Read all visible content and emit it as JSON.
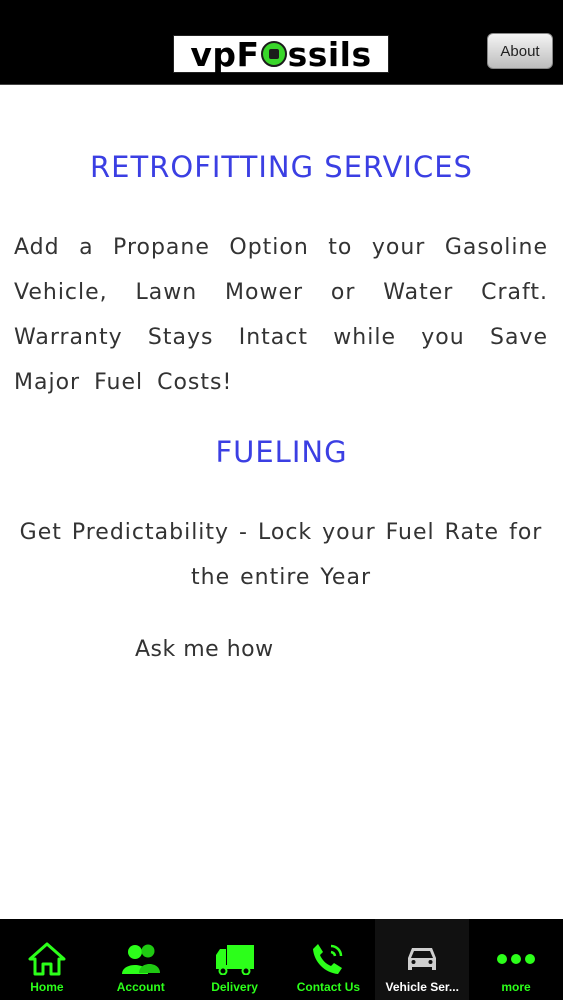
{
  "header": {
    "logo": {
      "text_before": "vpF",
      "text_after": "ssils",
      "icon": "fuel-pump-logo-icon"
    },
    "about_label": "About"
  },
  "content": {
    "retrofitting": {
      "title": "RETROFITTING SERVICES",
      "body": "Add a Propane Option to your Gasoline Vehicle, Lawn Mower or Water Craft. Warranty Stays Intact while you Save Major Fuel Costs!"
    },
    "fueling": {
      "title": "FUELING",
      "body": "Get Predictability - Lock your Fuel Rate for the entire Year",
      "ask": "Ask me how"
    }
  },
  "tabbar": {
    "tabs": [
      {
        "label": "Home",
        "icon": "home-icon",
        "active": false
      },
      {
        "label": "Account",
        "icon": "users-icon",
        "active": false
      },
      {
        "label": "Delivery",
        "icon": "truck-icon",
        "active": false
      },
      {
        "label": "Contact Us",
        "icon": "phone-icon",
        "active": false
      },
      {
        "label": "Vehicle Ser...",
        "icon": "car-icon",
        "active": true
      },
      {
        "label": "more",
        "icon": "more-dots-icon",
        "active": false
      }
    ]
  },
  "colors": {
    "header_bg": "#000000",
    "title_blue": "#3b3fe3",
    "body_text": "#333333",
    "tab_green": "#2cff1a",
    "tab_active_text": "#ffffff",
    "logo_green": "#39d62a"
  }
}
